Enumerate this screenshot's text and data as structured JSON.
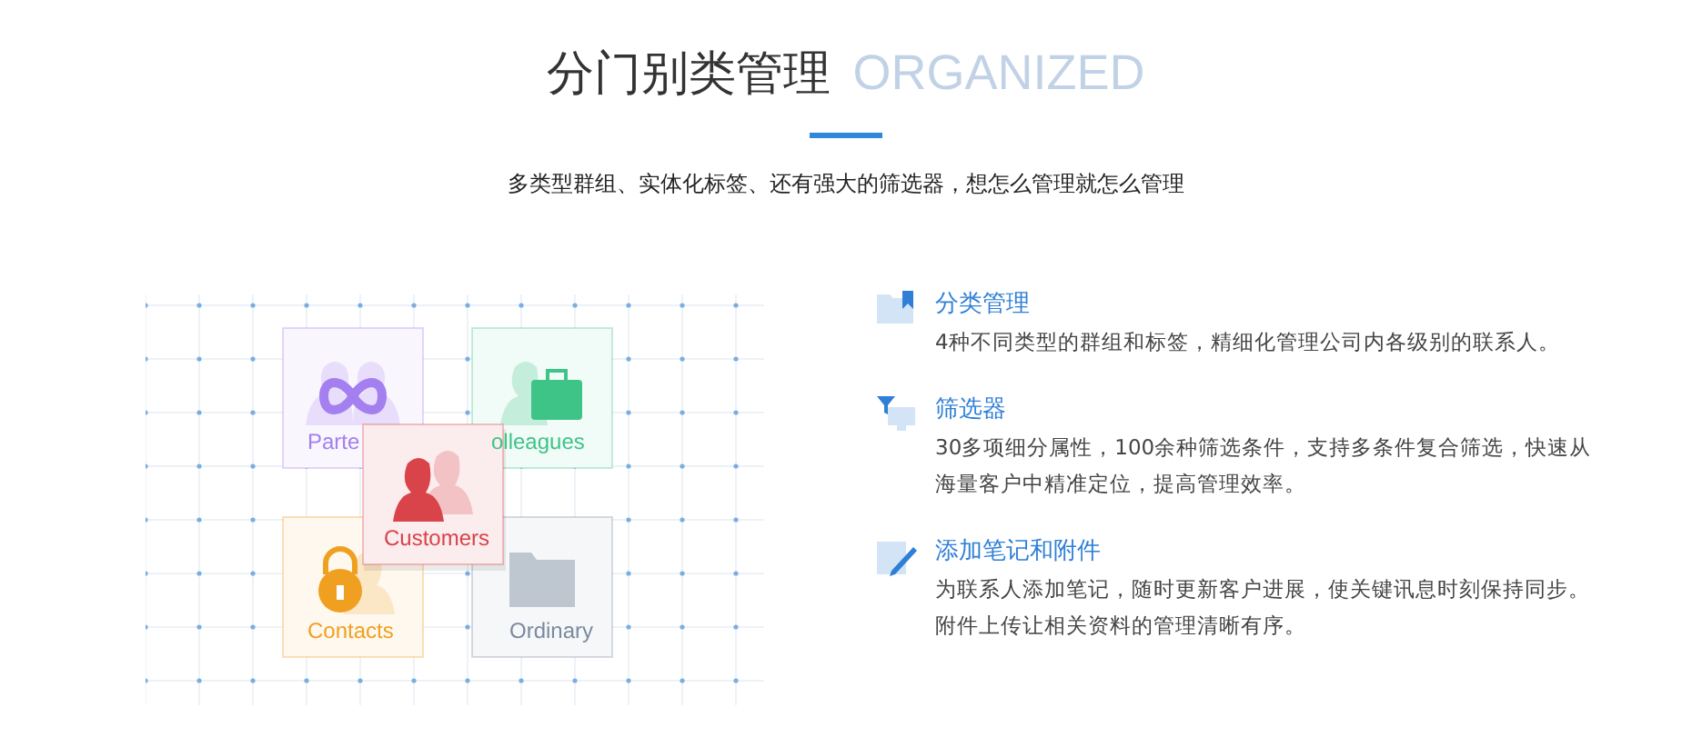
{
  "header": {
    "title": "分门别类管理",
    "title_en": "ORGANIZED",
    "subtitle": "多类型群组、实体化标签、还有强大的筛选器，想怎么管理就怎么管理"
  },
  "groups": [
    {
      "kind": "infinity",
      "label": "Parte",
      "color": "#a47ff0"
    },
    {
      "kind": "briefcase",
      "label": "olleagues",
      "color": "#3fc487"
    },
    {
      "kind": "lock",
      "label": "Contacts",
      "color": "#f0a020"
    },
    {
      "kind": "folder",
      "label": "Ordinary",
      "color": "#7a8aa0"
    },
    {
      "kind": "person",
      "label": "Customers",
      "color": "#d9434a"
    }
  ],
  "features": [
    {
      "kind": "bookmark",
      "title": "分类管理",
      "lines": [
        "4种不同类型的群组和标签，精细化管理公司内各级别的联系人。"
      ]
    },
    {
      "kind": "filter",
      "title": "筛选器",
      "lines": [
        "30多项细分属性，100余种筛选条件，支持多条件复合筛选，快速从",
        "海量客户中精准定位，提高管理效率。"
      ]
    },
    {
      "kind": "note",
      "title": "添加笔记和附件",
      "lines": [
        "为联系人添加笔记，随时更新客户进展，使关键讯息时刻保持同步。",
        "附件上传让相关资料的管理清晰有序。"
      ]
    }
  ]
}
